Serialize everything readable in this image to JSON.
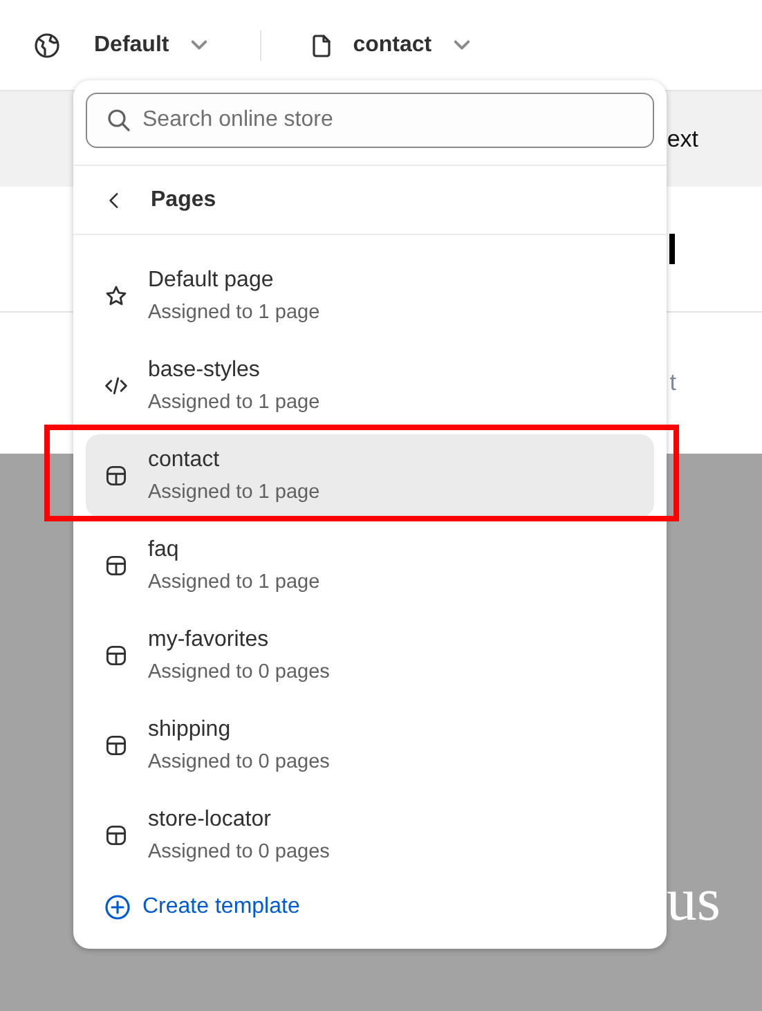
{
  "topbar": {
    "theme": "Default",
    "template": "contact"
  },
  "background": {
    "texts": [
      "ext",
      "t",
      "us"
    ]
  },
  "menu": {
    "search": {
      "placeholder": "Search online store"
    },
    "header": "Pages",
    "items": [
      {
        "kind": "star",
        "title": "Default page",
        "subtitle": "Assigned to 1 page",
        "selected": false
      },
      {
        "kind": "code",
        "title": "base-styles",
        "subtitle": "Assigned to 1 page",
        "selected": false
      },
      {
        "kind": "template",
        "title": "contact",
        "subtitle": "Assigned to 1 page",
        "selected": true
      },
      {
        "kind": "template",
        "title": "faq",
        "subtitle": "Assigned to 1 page",
        "selected": false
      },
      {
        "kind": "template",
        "title": "my-favorites",
        "subtitle": "Assigned to 0 pages",
        "selected": false
      },
      {
        "kind": "template",
        "title": "shipping",
        "subtitle": "Assigned to 0 pages",
        "selected": false
      },
      {
        "kind": "template",
        "title": "store-locator",
        "subtitle": "Assigned to 0 pages",
        "selected": false
      }
    ],
    "create": "Create template"
  }
}
